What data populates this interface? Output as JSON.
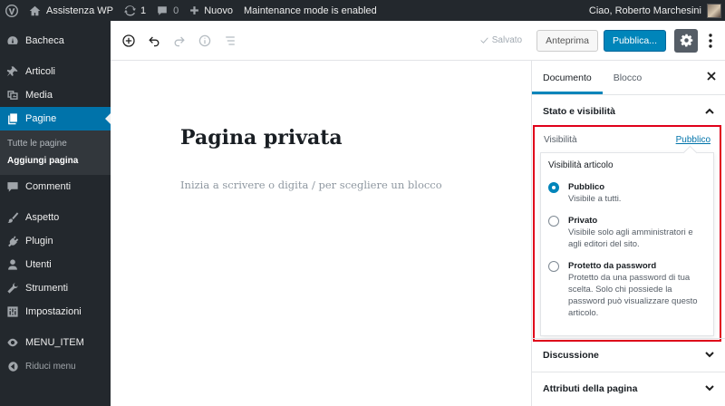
{
  "admin_bar": {
    "site_name": "Assistenza WP",
    "updates_count": "1",
    "comments_count": "0",
    "new_label": "Nuovo",
    "maintenance_notice": "Maintenance mode is enabled",
    "greeting": "Ciao, Roberto Marchesini"
  },
  "sidebar": {
    "dashboard": "Bacheca",
    "posts": "Articoli",
    "media": "Media",
    "pages": "Pagine",
    "pages_sub": [
      "Tutte le pagine",
      "Aggiungi pagina"
    ],
    "comments": "Commenti",
    "appearance": "Aspetto",
    "plugins": "Plugin",
    "users": "Utenti",
    "tools": "Strumenti",
    "settings": "Impostazioni",
    "menu_item": "MENU_ITEM",
    "collapse": "Riduci menu"
  },
  "toolbar": {
    "saved_label": "Salvato",
    "preview_label": "Anteprima",
    "publish_label": "Pubblica..."
  },
  "editor": {
    "title": "Pagina privata",
    "block_placeholder": "Inizia a scrivere o digita / per scegliere un blocco"
  },
  "settings_panel": {
    "tabs": [
      "Documento",
      "Blocco"
    ],
    "status_panel_title": "Stato e visibilità",
    "visibility_label": "Visibilità",
    "visibility_value": "Pubblico",
    "popover_legend": "Visibilità articolo",
    "options": [
      {
        "label": "Pubblico",
        "help": "Visibile a tutti.",
        "checked": true
      },
      {
        "label": "Privato",
        "help": "Visibile solo agli amministratori e agli editori del sito.",
        "checked": false
      },
      {
        "label": "Protetto da password",
        "help": "Protetto da una password di tua scelta. Solo chi possiede la password può visualizzare questo articolo.",
        "checked": false
      }
    ],
    "discussion_title": "Discussione",
    "page_attributes_title": "Attributi della pagina"
  },
  "colors": {
    "admin_dark": "#23282d",
    "accent_blue": "#0085ba",
    "highlight_red": "#e0001a"
  }
}
